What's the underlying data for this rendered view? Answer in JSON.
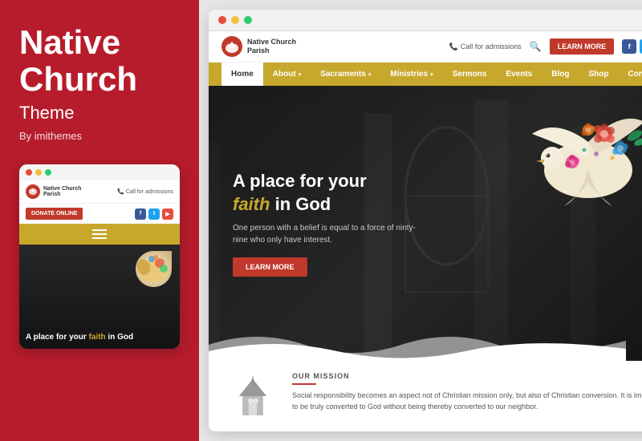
{
  "left": {
    "title_line1": "Native",
    "title_line2": "Church",
    "subtitle": "Theme",
    "by": "By imithemes"
  },
  "mobile": {
    "logo_name": "Native Church Parish",
    "phone": "Call for admissions",
    "donate_btn": "DONATE ONLINE",
    "social": [
      "f",
      "t",
      "y"
    ],
    "hero_text_part1": "A place for your ",
    "hero_faith": "faith",
    "hero_text_part2": " in God"
  },
  "browser": {
    "dots": [
      "red",
      "yellow",
      "green"
    ]
  },
  "site": {
    "logo_name": "Native Church Parish",
    "phone": "Call for admissions",
    "donate_btn": "DONATE ONLINE",
    "social": [
      "f",
      "t",
      "y"
    ],
    "nav": [
      {
        "label": "Home",
        "active": true
      },
      {
        "label": "About",
        "has_chevron": true
      },
      {
        "label": "Sacraments",
        "has_chevron": true
      },
      {
        "label": "Ministries",
        "has_chevron": true
      },
      {
        "label": "Sermons",
        "has_chevron": false
      },
      {
        "label": "Events",
        "has_chevron": false
      },
      {
        "label": "Blog",
        "has_chevron": false
      },
      {
        "label": "Shop",
        "has_chevron": false
      },
      {
        "label": "Contacts",
        "has_chevron": false
      }
    ],
    "hero": {
      "title_part1": "A place for your ",
      "faith": "faith",
      "title_part2": " in God",
      "subtitle": "One person with a belief is equal to a force of ninty-nine who only have interest.",
      "cta": "LEARN MORE"
    },
    "mission": {
      "label": "OUR MISSION",
      "body": "Social responsibility becomes an aspect not of Christian mission only, but also of Christian conversion. It is impossible to be truly converted to God without being thereby converted to our neighbor."
    }
  },
  "colors": {
    "red": "#b71c2c",
    "gold": "#c8a82c",
    "donate_red": "#c0392b",
    "fb": "#3b5998",
    "tw": "#1da1f2",
    "yt": "#e74c3c"
  }
}
